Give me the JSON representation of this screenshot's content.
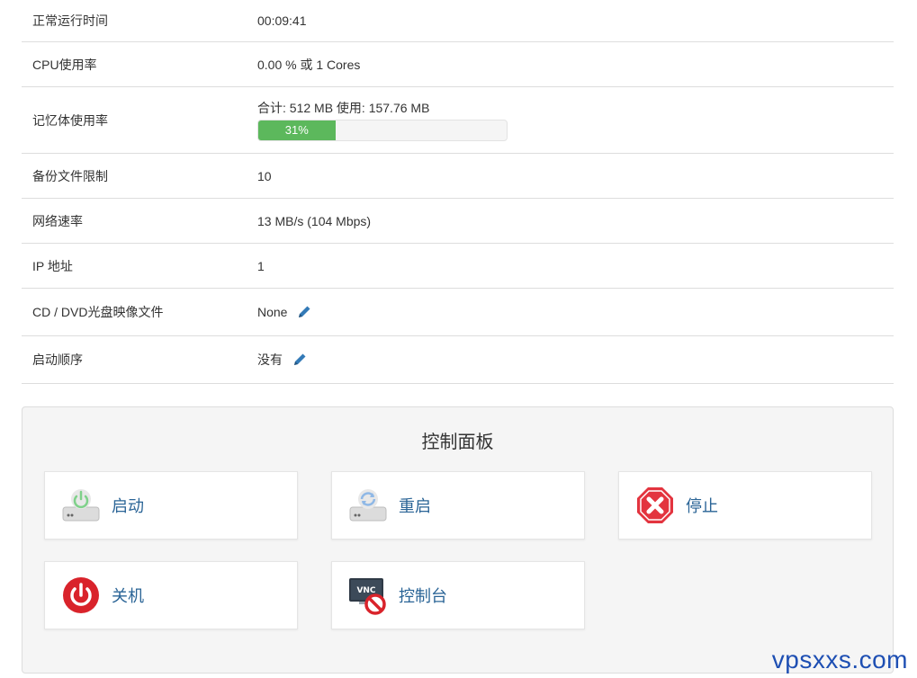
{
  "info_rows": [
    {
      "label": "正常运行时间",
      "value": "00:09:41"
    },
    {
      "label": "CPU使用率",
      "value": "0.00 % 或 1 Cores"
    },
    {
      "label": "记忆体使用率",
      "value": "合计: 512 MB 使用: 157.76 MB"
    },
    {
      "label": "备份文件限制",
      "value": "10"
    },
    {
      "label": "网络速率",
      "value": "13 MB/s (104 Mbps)"
    },
    {
      "label": "IP 地址",
      "value": "1"
    },
    {
      "label": "CD / DVD光盘映像文件",
      "value": "None"
    },
    {
      "label": "启动顺序",
      "value": "没有"
    }
  ],
  "memory": {
    "percent": 31,
    "percent_label": "31%"
  },
  "colors": {
    "progress": "#5cb85c",
    "link": "#2a6496",
    "stop": "#e3343f",
    "power": "#d9232b"
  },
  "control_panel": {
    "title": "控制面板",
    "actions": [
      {
        "label": "启动",
        "icon": "server-power-icon"
      },
      {
        "label": "重启",
        "icon": "server-reboot-icon"
      },
      {
        "label": "停止",
        "icon": "stop-octagon-icon"
      },
      {
        "label": "关机",
        "icon": "power-off-icon"
      },
      {
        "label": "控制台",
        "icon": "vnc-disabled-icon"
      }
    ]
  },
  "watermark": "vpsxxs.com"
}
